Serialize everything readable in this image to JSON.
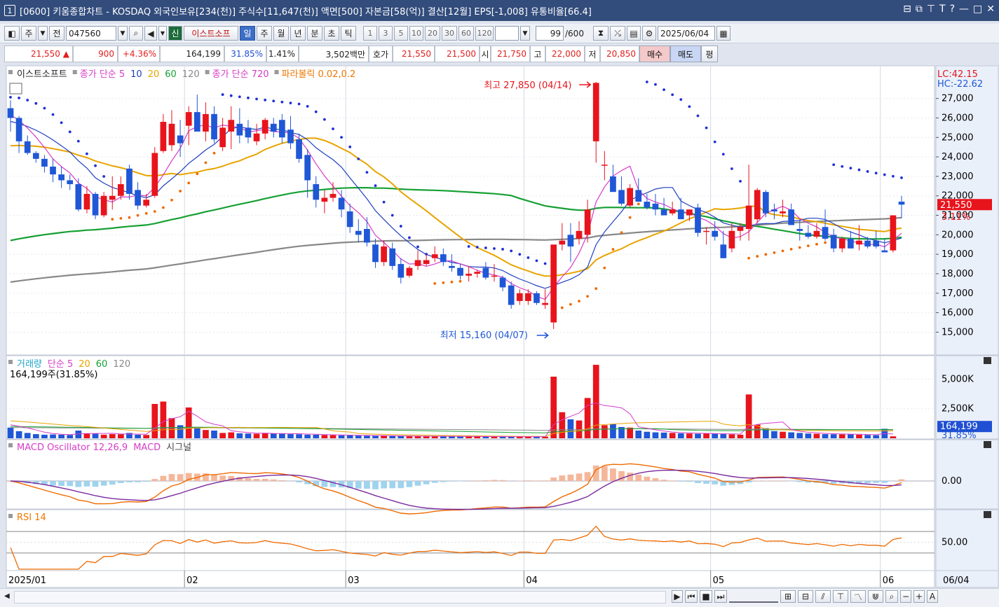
{
  "window": {
    "number": "1",
    "title": "[0600] 키움종합차트 - KOSDAQ 외국인보유[234(천)] 주식수[11,647(천)] 액면[500] 자본금[58(억)] 결산[12월] EPS[-1,008] 유통비율[66.4]",
    "controls": [
      "⊟",
      "⧉",
      "T",
      "T",
      "?",
      "—",
      "□",
      "✕"
    ]
  },
  "toolbar": {
    "market": "주",
    "prev": "전",
    "code": "047560",
    "company": "이스트소프",
    "periods": [
      "일",
      "주",
      "월",
      "년",
      "분",
      "초",
      "틱"
    ],
    "selected_period": "일",
    "minutes": [
      "1",
      "3",
      "5",
      "10",
      "20",
      "30",
      "60",
      "120"
    ],
    "count": "99",
    "count_total": "/600",
    "date": "2025/06/04",
    "new_label": "신"
  },
  "quote": {
    "price": "21,550",
    "arrow": "▲",
    "change": "900",
    "change_pct": "+4.36%",
    "volume": "164,199",
    "vol_ratio": "31.85%",
    "turnover": "1.41%",
    "amount": "3,502백만",
    "hoga_label": "호가",
    "ask": "21,550",
    "bid": "21,500",
    "open_label": "시",
    "open": "21,750",
    "high_label": "고",
    "high": "22,000",
    "low_label": "저",
    "low": "20,850",
    "buy": "매수",
    "sell": "매도",
    "eval": "평"
  },
  "price_pane": {
    "legend": [
      {
        "text": "이스트소프트",
        "color": "#222222"
      },
      {
        "text": "종가 단순 5",
        "color": "#d63cc8"
      },
      {
        "text": "10",
        "color": "#1f3fc0"
      },
      {
        "text": "20",
        "color": "#e8a400"
      },
      {
        "text": "60",
        "color": "#16a034"
      },
      {
        "text": "120",
        "color": "#888888"
      },
      {
        "text": "종가 단순 720",
        "color": "#d63cc8"
      },
      {
        "text": "파라볼릭 0.02,0.2",
        "color": "#ee7700"
      }
    ],
    "lc": "LC:42.15",
    "hc": "HC:-22.62",
    "price_tag": "21,550",
    "pct_tag": "3.11%",
    "high_note": "최고 27,850 (04/14)",
    "low_note": "최저 15,160 (04/07)",
    "yticks": [
      "27,000",
      "26,000",
      "25,000",
      "24,000",
      "23,000",
      "22,000",
      "21,000",
      "20,000",
      "19,000",
      "18,000",
      "17,000",
      "16,000",
      "15,000"
    ]
  },
  "volume_pane": {
    "legend": [
      {
        "text": "거래량",
        "color": "#1fa4c8"
      },
      {
        "text": "단순 5",
        "color": "#d63cc8"
      },
      {
        "text": "20",
        "color": "#e8a400"
      },
      {
        "text": "60",
        "color": "#16a034"
      },
      {
        "text": "120",
        "color": "#888888"
      }
    ],
    "sub": "164,199주(31.85%)",
    "yticks": [
      "5,000K",
      "2,500K"
    ],
    "vol_tag": "164,199",
    "pct_tag": "31.85%"
  },
  "macd_pane": {
    "legend": [
      {
        "text": "MACD Oscillator 12,26,9",
        "color": "#d63cc8"
      },
      {
        "text": "MACD",
        "color": "#d63cc8"
      },
      {
        "text": "시그널",
        "color": "#444444"
      }
    ],
    "ytick": "0.00"
  },
  "rsi_pane": {
    "legend": [
      {
        "text": "RSI 14",
        "color": "#ee7700"
      }
    ],
    "ytick": "50.00"
  },
  "xaxis": {
    "labels": [
      "2025/01",
      "02",
      "03",
      "04",
      "05",
      "06"
    ],
    "right": "06/04"
  },
  "colors": {
    "up": "#e8141c",
    "down": "#1f57d6",
    "ma5": "#d63cc8",
    "ma10": "#1f3fc0",
    "ma20": "#e8a400",
    "ma60": "#16a034",
    "ma120": "#888888",
    "sar": "#1f2fd6",
    "sar_up": "#ee6a00"
  },
  "chart_data": {
    "type": "candlestick",
    "period": "daily",
    "dates_range": [
      "2025/01",
      "2025/06/04"
    ],
    "ylim": [
      14600,
      28000
    ],
    "last": {
      "open": 21750,
      "high": 22000,
      "low": 20850,
      "close": 21550
    },
    "high": {
      "value": 27850,
      "date": "04/14"
    },
    "low": {
      "value": 15160,
      "date": "04/07"
    },
    "candles": [
      [
        26500,
        26900,
        25300,
        26000
      ],
      [
        26000,
        26100,
        24200,
        24800
      ],
      [
        24800,
        25100,
        24100,
        24200
      ],
      [
        24200,
        24300,
        23700,
        23900
      ],
      [
        23900,
        24100,
        23200,
        23500
      ],
      [
        23500,
        23900,
        22700,
        23100
      ],
      [
        23100,
        23500,
        22400,
        22800
      ],
      [
        22800,
        23100,
        22300,
        22600
      ],
      [
        22600,
        22900,
        21200,
        21300
      ],
      [
        21300,
        22500,
        21100,
        22100
      ],
      [
        22100,
        22200,
        20800,
        21000
      ],
      [
        21000,
        22200,
        20900,
        22000
      ],
      [
        21800,
        23000,
        21300,
        22000
      ],
      [
        22000,
        23000,
        21800,
        22600
      ],
      [
        23400,
        23600,
        21800,
        22100
      ],
      [
        22300,
        22700,
        21300,
        21500
      ],
      [
        21500,
        22100,
        21400,
        21800
      ],
      [
        22000,
        24500,
        21900,
        24200
      ],
      [
        24300,
        26200,
        24200,
        25800
      ],
      [
        24600,
        26400,
        24300,
        25700
      ],
      [
        25100,
        25900,
        24000,
        24700
      ],
      [
        25600,
        26600,
        24600,
        26300
      ],
      [
        26300,
        27200,
        25400,
        25300
      ],
      [
        25300,
        26800,
        24800,
        26200
      ],
      [
        26200,
        26600,
        24700,
        24900
      ],
      [
        24500,
        26000,
        24300,
        25500
      ],
      [
        25300,
        26600,
        24400,
        25900
      ],
      [
        25700,
        26500,
        24700,
        25100
      ],
      [
        25500,
        25900,
        24700,
        25000
      ],
      [
        24800,
        25700,
        24600,
        25200
      ],
      [
        25200,
        26000,
        24900,
        25900
      ],
      [
        25700,
        26000,
        25000,
        25300
      ],
      [
        25900,
        26200,
        24700,
        25000
      ],
      [
        25400,
        26100,
        24400,
        24700
      ],
      [
        24900,
        25200,
        23700,
        23900
      ],
      [
        24100,
        24400,
        21900,
        22800
      ],
      [
        22600,
        23000,
        21400,
        21800
      ],
      [
        21700,
        22300,
        21100,
        21900
      ],
      [
        21900,
        22700,
        21700,
        22100
      ],
      [
        21900,
        22300,
        20900,
        21300
      ],
      [
        21200,
        21600,
        20100,
        20400
      ],
      [
        20200,
        20800,
        19600,
        20000
      ],
      [
        20300,
        20900,
        19400,
        19600
      ],
      [
        19500,
        19800,
        18300,
        18600
      ],
      [
        18600,
        19700,
        18400,
        19400
      ],
      [
        19300,
        19600,
        18200,
        18400
      ],
      [
        18500,
        18800,
        17500,
        17800
      ],
      [
        17900,
        18400,
        17800,
        18300
      ],
      [
        18400,
        19200,
        18200,
        18700
      ],
      [
        18500,
        19000,
        18400,
        18700
      ],
      [
        18800,
        19400,
        18600,
        19000
      ],
      [
        19000,
        19300,
        18400,
        18600
      ],
      [
        18400,
        19000,
        18100,
        18300
      ],
      [
        18300,
        18500,
        17700,
        17900
      ],
      [
        17900,
        18400,
        17600,
        18000
      ],
      [
        18000,
        18200,
        17800,
        18100
      ],
      [
        18300,
        18600,
        17700,
        17800
      ],
      [
        17900,
        18500,
        17600,
        17900
      ],
      [
        17800,
        17900,
        17100,
        17300
      ],
      [
        17400,
        17600,
        16200,
        16400
      ],
      [
        16600,
        17200,
        16400,
        17000
      ],
      [
        16600,
        17200,
        16400,
        17000
      ],
      [
        17000,
        17100,
        16400,
        16500
      ],
      [
        16400,
        17200,
        16200,
        16500
      ],
      [
        15500,
        18900,
        15160,
        19500
      ],
      [
        19500,
        20600,
        19200,
        19700
      ],
      [
        20000,
        20600,
        18600,
        19400
      ],
      [
        19800,
        20700,
        19500,
        20200
      ],
      [
        20000,
        21800,
        19600,
        21300
      ],
      [
        24800,
        27850,
        23700,
        27800
      ],
      [
        23600,
        24300,
        22800,
        23600
      ],
      [
        23000,
        23600,
        22200,
        22200
      ],
      [
        22300,
        23000,
        21500,
        21600
      ],
      [
        21500,
        22600,
        21400,
        22400
      ],
      [
        22300,
        22900,
        21800,
        21700
      ],
      [
        21700,
        22100,
        21300,
        21400
      ],
      [
        21600,
        22100,
        21000,
        21300
      ],
      [
        21300,
        21900,
        21100,
        21000
      ],
      [
        21100,
        21700,
        21000,
        21300
      ],
      [
        21300,
        21900,
        20900,
        20800
      ],
      [
        21000,
        21200,
        20700,
        21300
      ],
      [
        21400,
        21600,
        19900,
        20100
      ],
      [
        20200,
        20400,
        19500,
        20200
      ],
      [
        20200,
        20700,
        19700,
        19900
      ],
      [
        19500,
        20200,
        18800,
        18800
      ],
      [
        19300,
        20600,
        19100,
        20200
      ],
      [
        20200,
        20600,
        19700,
        20400
      ],
      [
        20300,
        23600,
        19700,
        21500
      ],
      [
        20800,
        22400,
        20600,
        22300
      ],
      [
        22200,
        22300,
        20900,
        21100
      ],
      [
        21300,
        21600,
        20800,
        21200
      ],
      [
        21100,
        21800,
        20900,
        21200
      ],
      [
        21300,
        21600,
        20500,
        20500
      ],
      [
        20300,
        20800,
        19700,
        20200
      ],
      [
        20100,
        20500,
        19800,
        19900
      ],
      [
        19900,
        20600,
        19800,
        20200
      ],
      [
        20400,
        21300,
        19700,
        19800
      ],
      [
        20000,
        20300,
        19100,
        19300
      ],
      [
        19300,
        19900,
        19100,
        19800
      ],
      [
        19800,
        20200,
        19300,
        19300
      ],
      [
        19500,
        20500,
        19200,
        19700
      ],
      [
        19700,
        19900,
        19300,
        19400
      ],
      [
        19700,
        20200,
        19300,
        19400
      ],
      [
        19200,
        19800,
        19100,
        19100
      ],
      [
        19200,
        21000,
        19100,
        21000
      ],
      [
        21700,
        22000,
        20850,
        21550
      ]
    ],
    "volumes_k": [
      900,
      600,
      450,
      350,
      300,
      320,
      300,
      280,
      650,
      420,
      380,
      300,
      350,
      340,
      450,
      300,
      280,
      2900,
      3100,
      1700,
      1100,
      2600,
      850,
      700,
      650,
      450,
      500,
      420,
      400,
      380,
      450,
      400,
      380,
      350,
      340,
      300,
      300,
      280,
      260,
      250,
      240,
      230,
      220,
      200,
      210,
      190,
      180,
      170,
      180,
      170,
      160,
      170,
      150,
      140,
      150,
      150,
      140,
      140,
      130,
      130,
      140,
      140,
      120,
      130,
      5200,
      2200,
      1600,
      1500,
      3400,
      6200,
      1100,
      1200,
      950,
      900,
      650,
      550,
      500,
      480,
      450,
      420,
      400,
      380,
      420,
      380,
      350,
      330,
      300,
      3700,
      1150,
      850,
      600,
      550,
      500,
      450,
      400,
      380,
      350,
      340,
      330,
      350,
      300,
      280,
      260,
      800,
      164
    ]
  }
}
